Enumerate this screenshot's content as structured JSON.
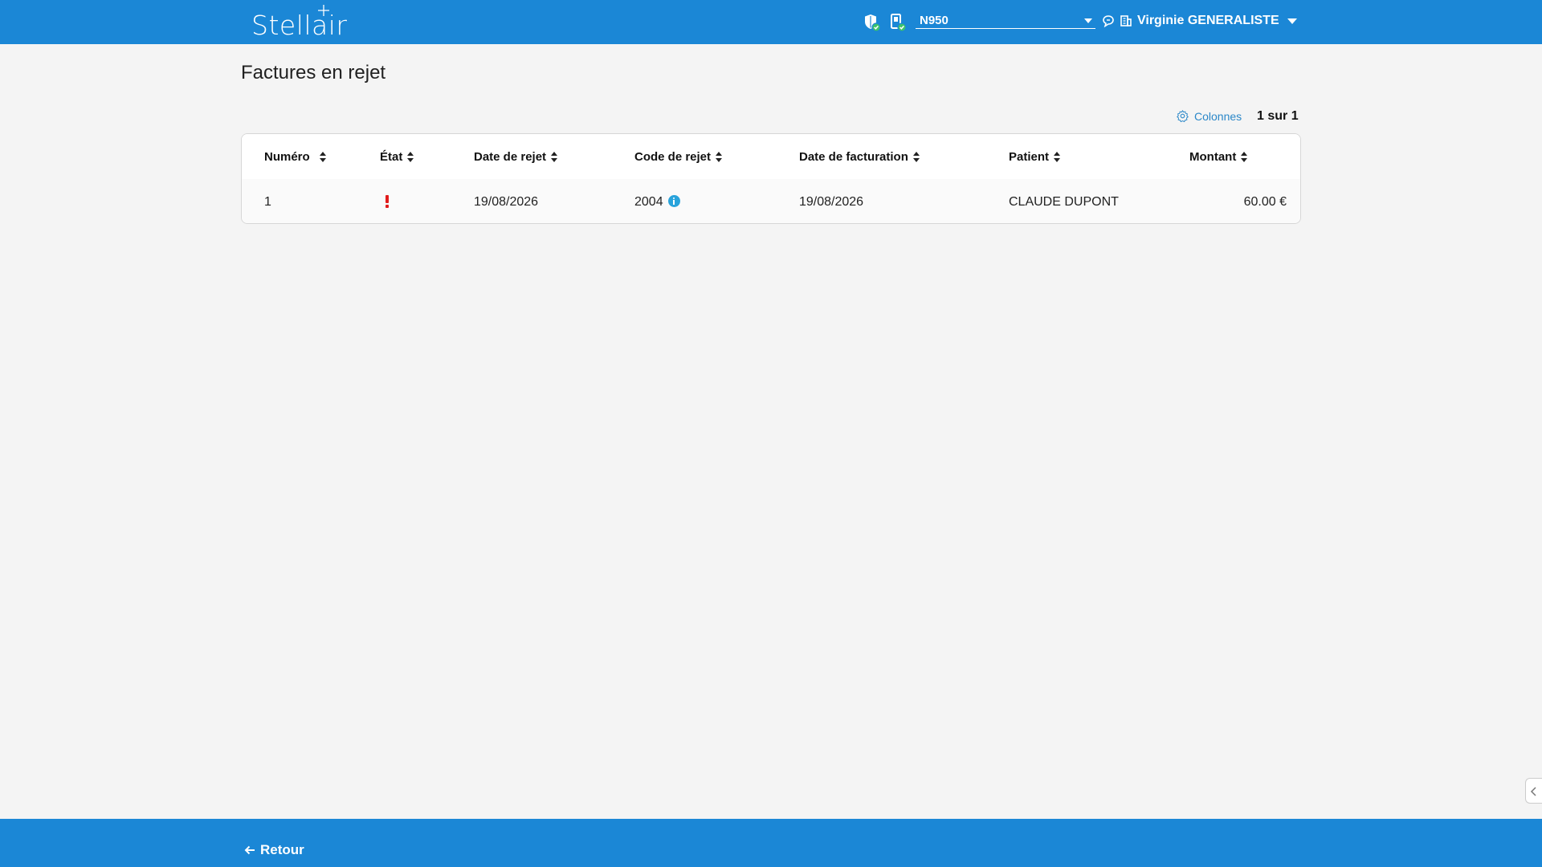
{
  "header": {
    "logo_text": "Stellair",
    "device": "N950",
    "user_name": "Virginie GENERALISTE",
    "brand_color": "#1b87d6",
    "icons": [
      "shield-check-icon",
      "card-reader-icon",
      "chat-icon",
      "building-icon"
    ]
  },
  "page": {
    "title": "Factures en rejet"
  },
  "toolbar": {
    "columns_label": "Colonnes",
    "pagination": "1 sur 1"
  },
  "table": {
    "columns": [
      "Numéro",
      "État",
      "Date de rejet",
      "Code de rejet",
      "Date de facturation",
      "Patient",
      "Montant"
    ],
    "rows": [
      {
        "numero": "1",
        "etat": "error-icon",
        "date_rejet": "19/08/2026",
        "code_rejet": "2004",
        "date_facturation": "19/08/2026",
        "patient": "CLAUDE DUPONT",
        "montant": "60.00 €"
      }
    ]
  },
  "footer": {
    "back_label": "Retour"
  }
}
